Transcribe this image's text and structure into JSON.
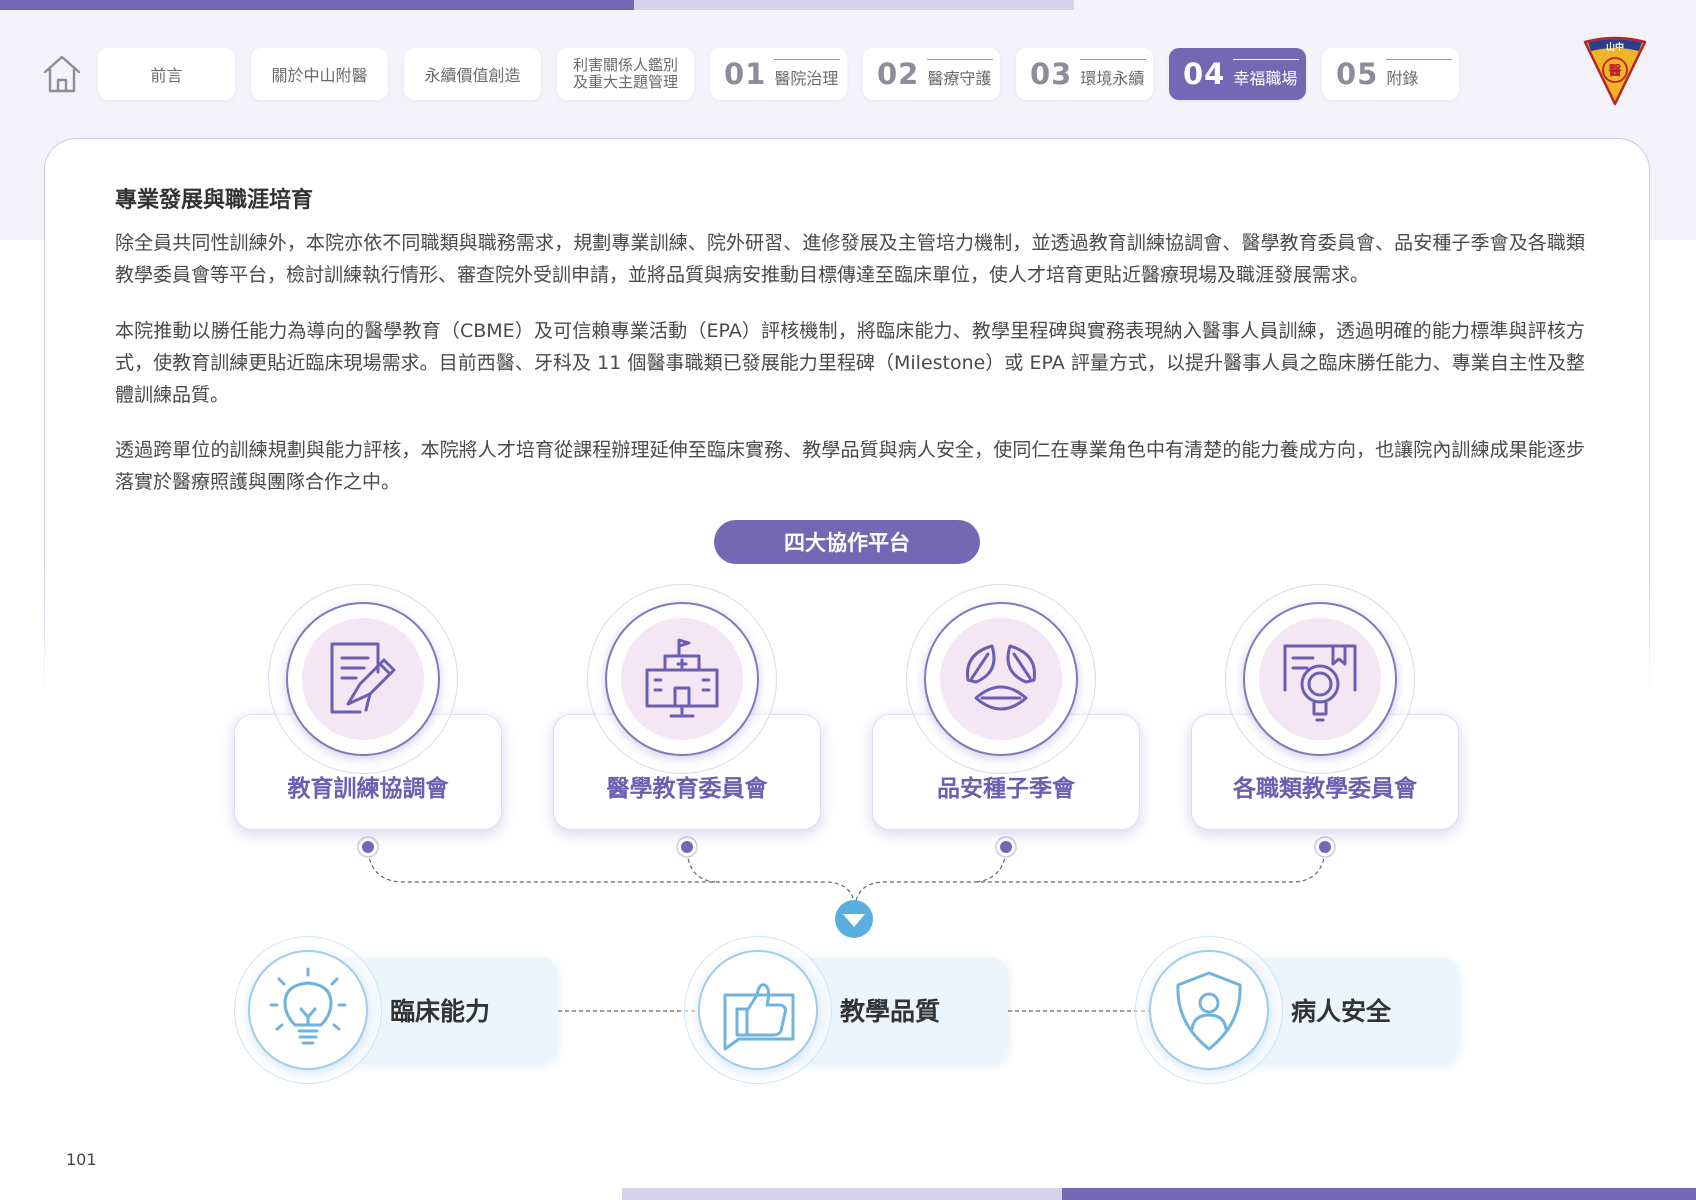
{
  "nav": {
    "items": [
      {
        "label": "前言"
      },
      {
        "label": "關於中山附醫"
      },
      {
        "label": "永續價值創造"
      },
      {
        "line1": "利害關係人鑑別",
        "line2": "及重大主題管理"
      },
      {
        "num": "01",
        "label": "醫院治理"
      },
      {
        "num": "02",
        "label": "醫療守護"
      },
      {
        "num": "03",
        "label": "環境永續"
      },
      {
        "num": "04",
        "label": "幸福職場"
      },
      {
        "num": "05",
        "label": "附錄"
      }
    ],
    "active_index": 7
  },
  "logo": {
    "text": "山中",
    "seal": "醫"
  },
  "section": {
    "title": "專業發展與職涯培育",
    "paragraphs": [
      "除全員共同性訓練外，本院亦依不同職類與職務需求，規劃專業訓練、院外研習、進修發展及主管培力機制，並透過教育訓練協調會、醫學教育委員會、品安種子季會及各職類教學委員會等平台，檢討訓練執行情形、審查院外受訓申請，並將品質與病安推動目標傳達至臨床單位，使人才培育更貼近醫療現場及職涯發展需求。",
      "本院推動以勝任能力為導向的醫學教育（CBME）及可信賴專業活動（EPA）評核機制，將臨床能力、教學里程碑與實務表現納入醫事人員訓練，透過明確的能力標準與評核方式，使教育訓練更貼近臨床現場需求。目前西醫、牙科及 11 個醫事職類已發展能力里程碑（Milestone）或 EPA 評量方式，以提升醫事人員之臨床勝任能力、專業自主性及整體訓練品質。",
      "透過跨單位的訓練規劃與能力評核，本院將人才培育從課程辦理延伸至臨床實務、教學品質與病人安全，使同仁在專業角色中有清楚的能力養成方向，也讓院內訓練成果能逐步落實於醫療照護與團隊合作之中。"
    ]
  },
  "diagram": {
    "header": "四大協作平台",
    "platforms": [
      {
        "label": "教育訓練協調會",
        "icon": "document-pen-icon"
      },
      {
        "label": "醫學教育委員會",
        "icon": "hospital-screen-icon"
      },
      {
        "label": "品安種子季會",
        "icon": "leaves-icon"
      },
      {
        "label": "各職類教學委員會",
        "icon": "book-magnifier-icon"
      }
    ],
    "outcomes": [
      {
        "label": "臨床能力",
        "icon": "lightbulb-icon"
      },
      {
        "label": "教學品質",
        "icon": "thumbs-up-icon"
      },
      {
        "label": "病人安全",
        "icon": "shield-person-icon"
      }
    ]
  },
  "colors": {
    "primary": "#7468b4",
    "accent_blue": "#5aaee0",
    "pink_tint": "#f4e6f3"
  },
  "page_number": "101"
}
